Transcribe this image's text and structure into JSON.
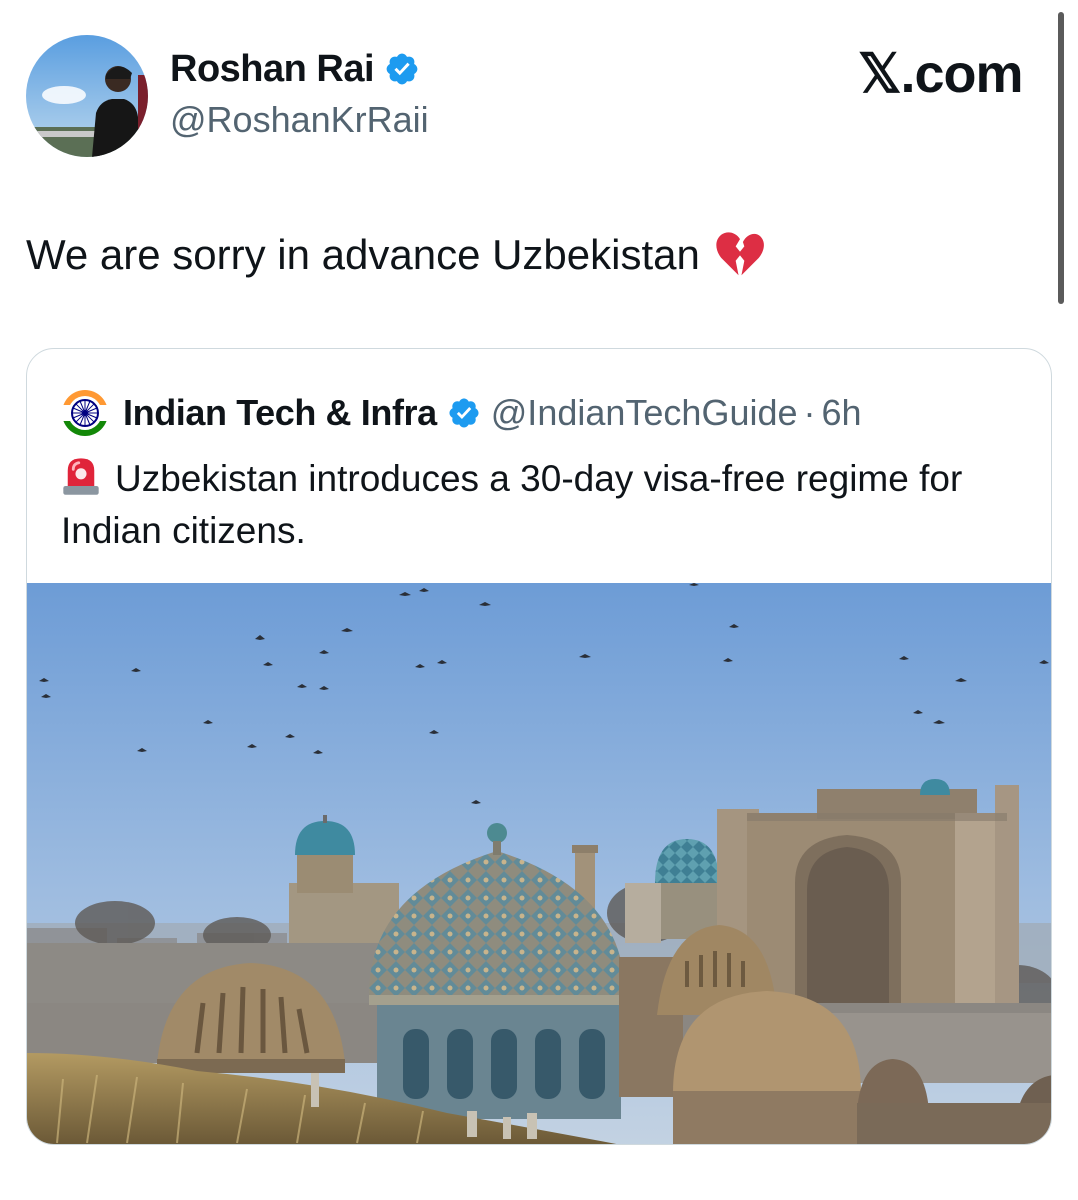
{
  "author": {
    "name": "Roshan Rai",
    "handle": "@RoshanKrRaii",
    "verified_icon": "verified-badge-icon",
    "avatar": "avatar-photo"
  },
  "brand": {
    "label": "𝕏.com"
  },
  "tweet": {
    "text": "We are sorry in advance Uzbekistan",
    "emoji": "broken-heart-icon"
  },
  "quoted_tweet": {
    "name": "Indian Tech & Infra",
    "handle": "@IndianTechGuide",
    "separator": "·",
    "time": "6h",
    "avatar_icon": "indian-flag-chakra-icon",
    "verified_icon": "verified-badge-icon",
    "siren_icon": "police-light-icon",
    "text": "Uzbekistan introduces a 30-day visa-free regime for Indian citizens.",
    "image": "samarkand-domes-photo"
  },
  "colors": {
    "verified": "#1d9bf0",
    "secondary_text": "#536471",
    "border": "#cfd9de",
    "sky": "#6f9fd8"
  }
}
